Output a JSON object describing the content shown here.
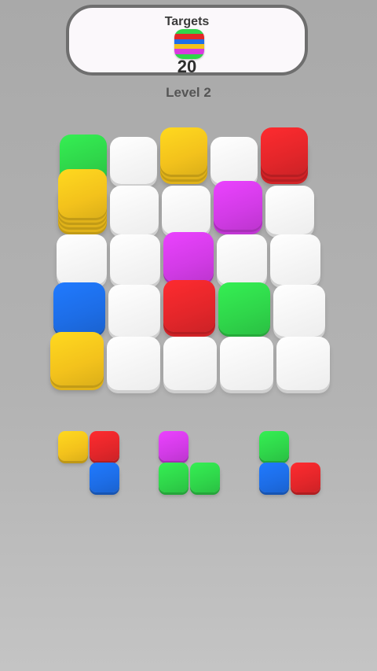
{
  "header": {
    "title": "Targets",
    "count": "20",
    "icon": "rainbow-stack-icon",
    "icon_stripes": [
      "#2fd54a",
      "#e22727",
      "#1f6fe8",
      "#f3c21c",
      "#d93ae0",
      "#2fd54a"
    ]
  },
  "level": {
    "label": "Level 2"
  },
  "colors": {
    "green": "#2fd54a",
    "yellow": "#f3c21c",
    "red": "#e3262a",
    "purple": "#d23be6",
    "blue": "#1d6de6",
    "empty": "#f4f4f4"
  },
  "board": {
    "rows": 5,
    "cols": 5,
    "cells": [
      [
        "green",
        "empty",
        "yellow",
        "empty",
        "red"
      ],
      [
        "yellow",
        "empty",
        "empty",
        "purple",
        "empty"
      ],
      [
        "empty",
        "empty",
        "purple",
        "empty",
        "empty"
      ],
      [
        "blue",
        "empty",
        "red",
        "green",
        "empty"
      ],
      [
        "yellow",
        "empty",
        "empty",
        "empty",
        "empty"
      ]
    ],
    "stack_heights": [
      [
        1,
        0,
        4,
        0,
        4
      ],
      [
        7,
        0,
        0,
        2,
        0
      ],
      [
        0,
        0,
        1,
        0,
        0
      ],
      [
        1,
        0,
        2,
        1,
        0
      ],
      [
        2,
        0,
        0,
        0,
        0
      ]
    ]
  },
  "tray": {
    "pieces": [
      {
        "name": "tray-piece-1",
        "cells": [
          {
            "col": 0,
            "row": 0,
            "color": "yellow"
          },
          {
            "col": 1,
            "row": 0,
            "color": "red"
          },
          {
            "col": 1,
            "row": 1,
            "color": "blue"
          }
        ]
      },
      {
        "name": "tray-piece-2",
        "cells": [
          {
            "col": 0,
            "row": 0,
            "color": "purple"
          },
          {
            "col": 0,
            "row": 1,
            "color": "green"
          },
          {
            "col": 1,
            "row": 1,
            "color": "green"
          }
        ]
      },
      {
        "name": "tray-piece-3",
        "cells": [
          {
            "col": 0,
            "row": 0,
            "color": "green"
          },
          {
            "col": 0,
            "row": 1,
            "color": "blue"
          },
          {
            "col": 1,
            "row": 1,
            "color": "red"
          }
        ]
      }
    ]
  }
}
